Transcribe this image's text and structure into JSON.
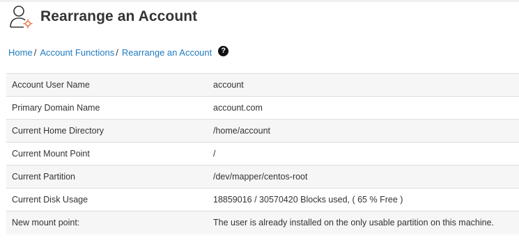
{
  "header": {
    "title": "Rearrange an Account",
    "icon": "user-rearrange-icon"
  },
  "breadcrumb": {
    "items": [
      {
        "label": "Home"
      },
      {
        "label": "Account Functions"
      },
      {
        "label": "Rearrange an Account"
      }
    ],
    "separator": "/",
    "help_icon": "question-circle-icon",
    "help_glyph": "?"
  },
  "details": {
    "rows": [
      {
        "label": "Account User Name",
        "value": "account"
      },
      {
        "label": "Primary Domain Name",
        "value": "account.com"
      },
      {
        "label": "Current Home Directory",
        "value": "/home/account"
      },
      {
        "label": "Current Mount Point",
        "value": "/"
      },
      {
        "label": "Current Partition",
        "value": "/dev/mapper/centos-root"
      },
      {
        "label": "Current Disk Usage",
        "value": "18859016 / 30570420 Blocks used, ( 65 % Free )"
      },
      {
        "label": "New mount point:",
        "value": "The user is already installed on the only usable partition on this machine."
      }
    ]
  },
  "colors": {
    "link": "#1e7bbf",
    "text": "#333333",
    "row_alt": "#f6f6f6",
    "icon_accent": "#e8693a"
  }
}
